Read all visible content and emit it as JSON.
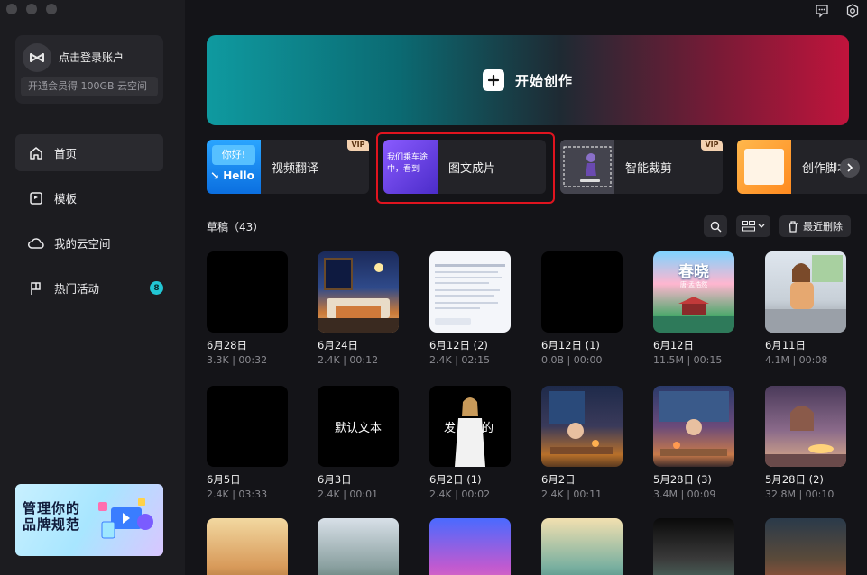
{
  "sidebar": {
    "account": {
      "login": "点击登录账户",
      "vip": "开通会员得 100GB 云空间"
    },
    "nav": [
      {
        "label": "首页",
        "icon": "home-icon",
        "active": true
      },
      {
        "label": "模板",
        "icon": "template-icon"
      },
      {
        "label": "我的云空间",
        "icon": "cloud-icon"
      },
      {
        "label": "热门活动",
        "icon": "flag-icon",
        "badge": "8"
      }
    ],
    "promo": {
      "line1": "管理你的",
      "line2": "品牌规范"
    }
  },
  "hero": {
    "label": "开始创作"
  },
  "features": [
    {
      "label": "视频翻译",
      "vip": "VIP",
      "thumb_text_top": "你好!",
      "thumb_text_bottom": "Hello"
    },
    {
      "label": "图文成片",
      "thumb_text": "我们乘车途中，看到"
    },
    {
      "label": "智能裁剪",
      "vip": "VIP"
    },
    {
      "label": "创作脚本"
    }
  ],
  "drafts": {
    "title": "草稿（43）",
    "recent_delete": "最近删除",
    "items": [
      {
        "name": "6月28日",
        "meta": "3.3K | 00:32",
        "thumb": "black"
      },
      {
        "name": "6月24日",
        "meta": "2.4K | 00:12",
        "thumb": "bedroom"
      },
      {
        "name": "6月12日 (2)",
        "meta": "2.4K | 02:15",
        "thumb": "document"
      },
      {
        "name": "6月12日 (1)",
        "meta": "0.0B | 00:00",
        "thumb": "black"
      },
      {
        "name": "6月12日",
        "meta": "11.5M | 00:15",
        "thumb": "spring",
        "thumb_text": "春晓",
        "thumb_sub": "唐·孟浩然"
      },
      {
        "name": "6月11日",
        "meta": "4.1M | 00:08",
        "thumb": "train"
      },
      {
        "name": "6月5日",
        "meta": "2.4K | 03:33",
        "thumb": "black"
      },
      {
        "name": "6月3日",
        "meta": "2.4K | 00:01",
        "thumb": "text",
        "thumb_text": "默认文本"
      },
      {
        "name": "6月2日 (1)",
        "meta": "2.4K | 00:02",
        "thumb": "person",
        "thumb_text_l": "发",
        "thumb_text_r": "的"
      },
      {
        "name": "6月2日",
        "meta": "2.4K | 00:11",
        "thumb": "night-room"
      },
      {
        "name": "5月28日 (3)",
        "meta": "3.4M | 00:09",
        "thumb": "cafe"
      },
      {
        "name": "5月28日 (2)",
        "meta": "32.8M | 00:10",
        "thumb": "eating"
      },
      {
        "name": "",
        "meta": "",
        "thumb": "poem"
      },
      {
        "name": "",
        "meta": "",
        "thumb": "village"
      },
      {
        "name": "",
        "meta": "",
        "thumb": "neon"
      },
      {
        "name": "",
        "meta": "",
        "thumb": "mountain"
      },
      {
        "name": "",
        "meta": "",
        "thumb": "dark-mountain"
      },
      {
        "name": "",
        "meta": "",
        "thumb": "canal"
      }
    ]
  },
  "colors": {
    "accent": "#22c6d4",
    "highlight": "#e0141f",
    "vip": "#f3d1b0"
  }
}
